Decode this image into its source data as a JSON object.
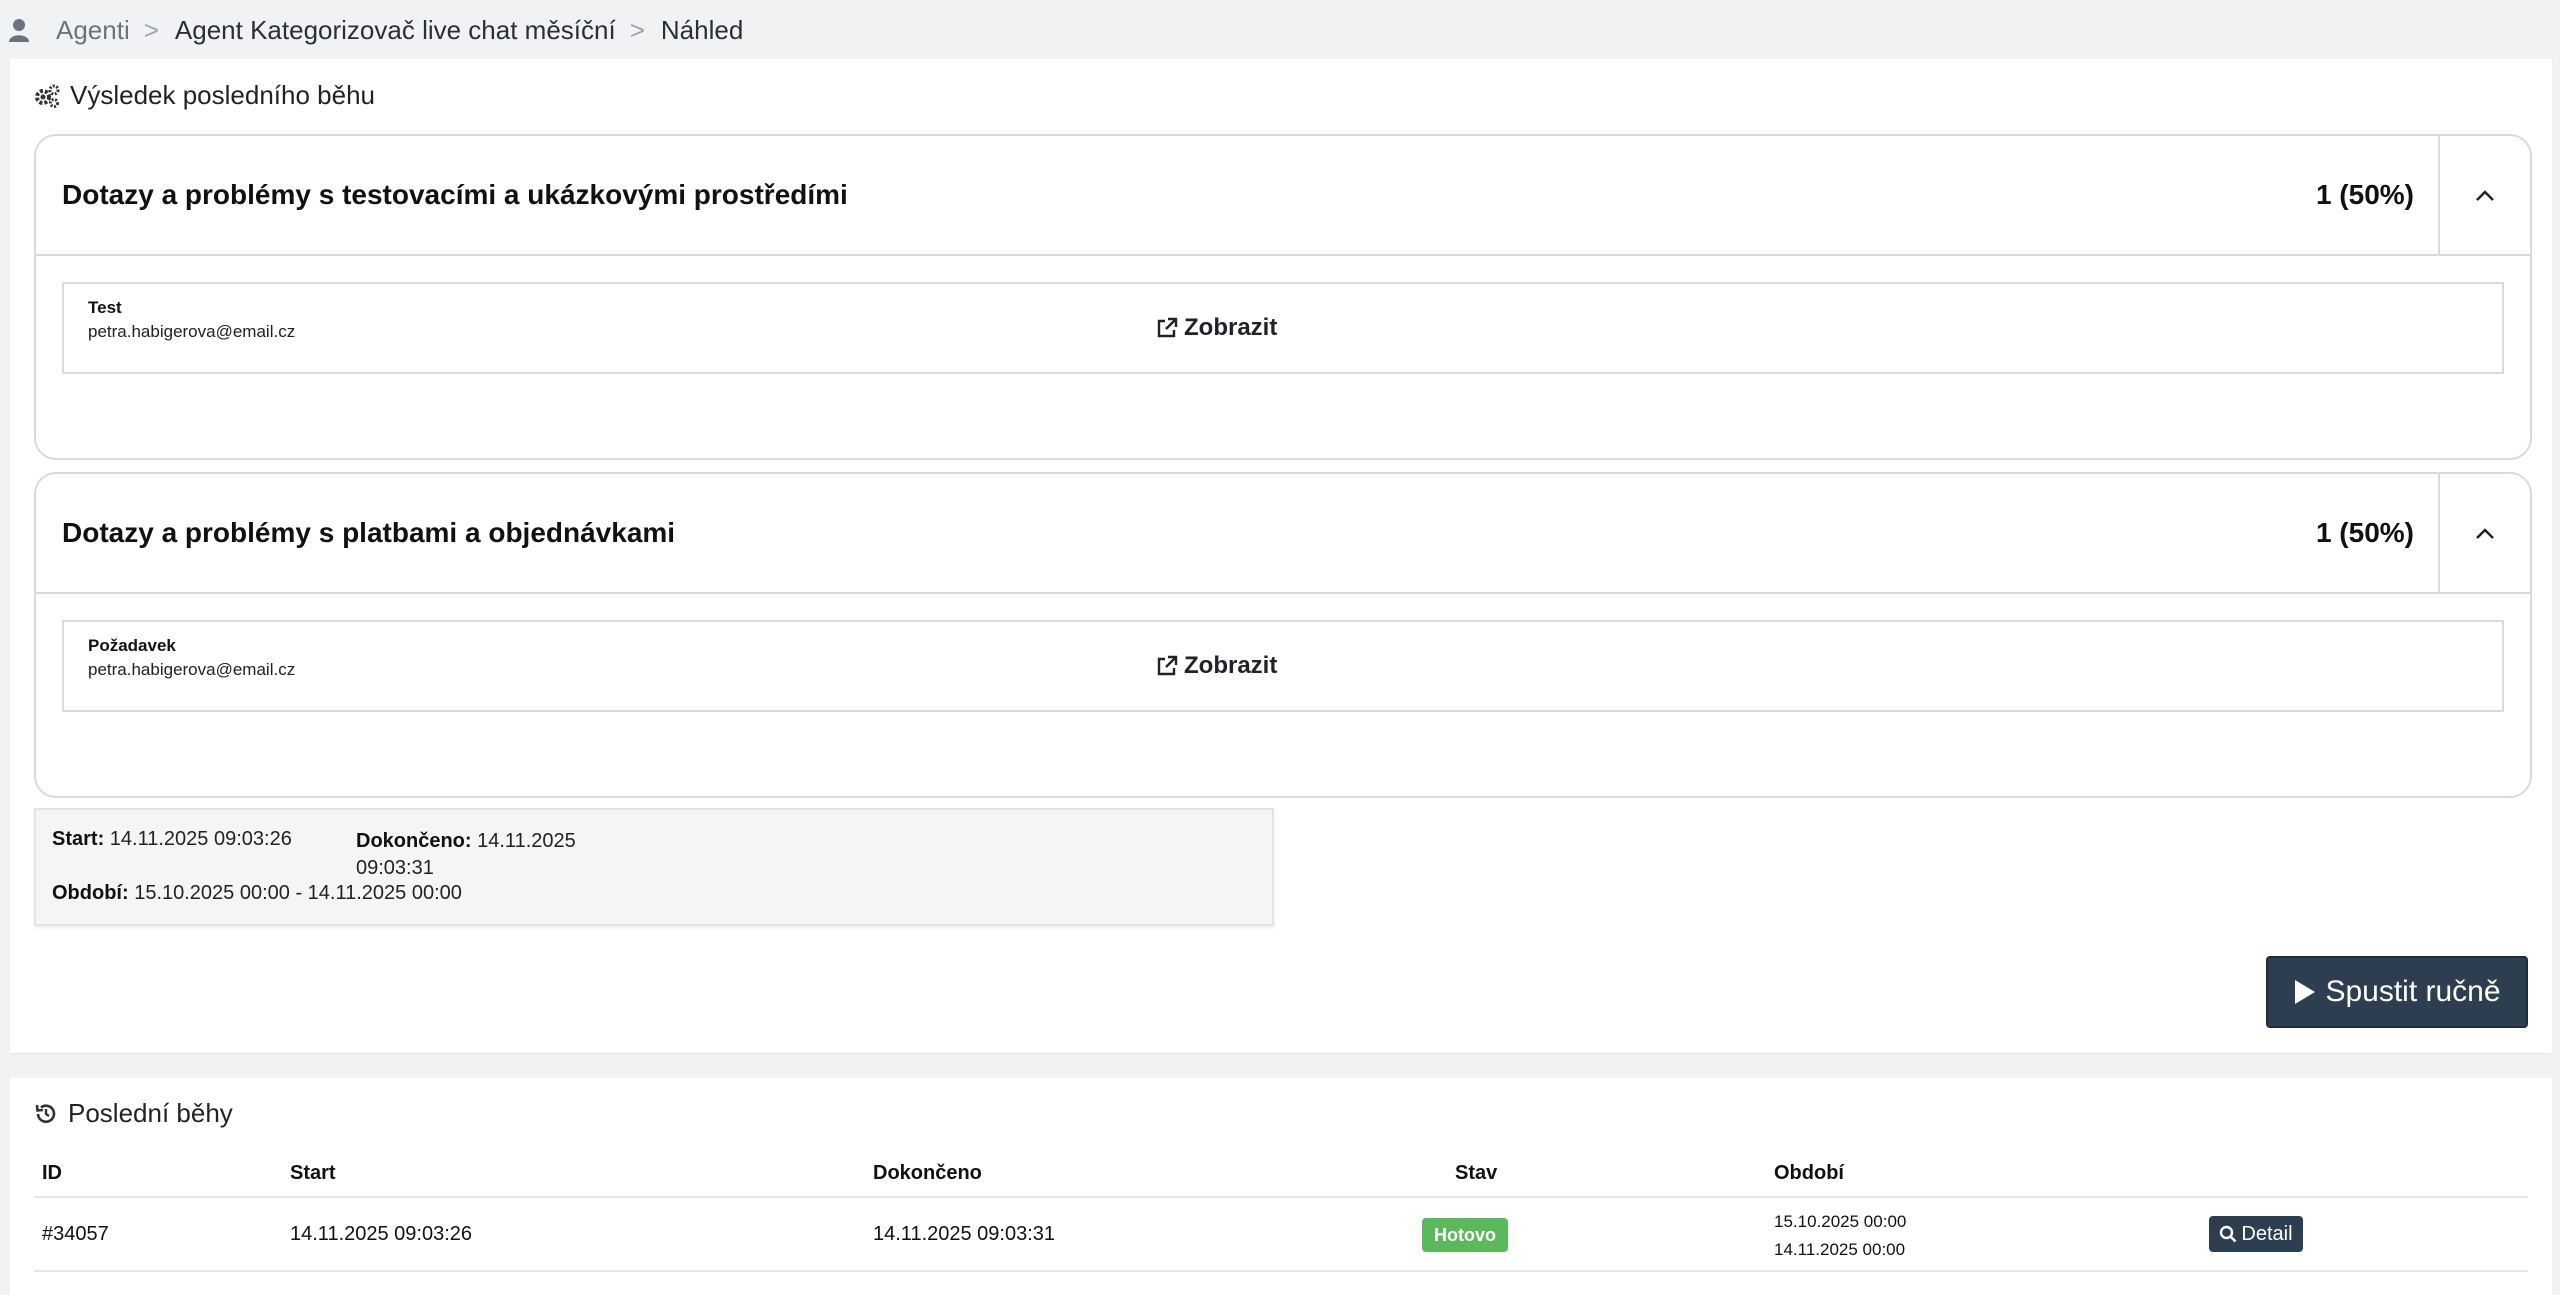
{
  "breadcrumb": {
    "items": [
      "Agenti",
      "Agent Kategorizovač live chat měsíční",
      "Náhled"
    ],
    "separator": ">"
  },
  "result": {
    "title": "Výsledek posledního běhu",
    "categories": [
      {
        "title": "Dotazy a problémy s testovacími a ukázkovými prostředími",
        "count": "1 (50%)",
        "item": {
          "name": "Test",
          "email": "petra.habigerova@email.cz",
          "link_label": "Zobrazit"
        }
      },
      {
        "title": "Dotazy a problémy s platbami a objednávkami",
        "count": "1 (50%)",
        "item": {
          "name": "Požadavek",
          "email": "petra.habigerova@email.cz",
          "link_label": "Zobrazit"
        }
      }
    ],
    "info": {
      "start_label": "Start:",
      "start_value": "14.11.2025 09:03:26",
      "done_label": "Dokončeno:",
      "done_value": "14.11.2025 09:03:31",
      "period_label": "Období:",
      "period_value": "15.10.2025 00:00 - 14.11.2025 00:00"
    },
    "run_button": "Spustit ručně"
  },
  "runs": {
    "title": "Poslední běhy",
    "columns": [
      "ID",
      "Start",
      "Dokončeno",
      "Stav",
      "Období"
    ],
    "rows": [
      {
        "id": "#34057",
        "start": "14.11.2025 09:03:26",
        "done": "14.11.2025 09:03:31",
        "status": "Hotovo",
        "period_from": "15.10.2025 00:00",
        "period_to": "14.11.2025 00:00",
        "detail_label": "Detail"
      }
    ]
  },
  "colors": {
    "primary_button": "#2d3e50",
    "status_done": "#5cb85c",
    "border": "#d7dbe0"
  },
  "icons": [
    "user-icon",
    "cogs-icon",
    "chevron-up-icon",
    "external-link-icon",
    "play-icon",
    "history-icon",
    "search-icon"
  ]
}
